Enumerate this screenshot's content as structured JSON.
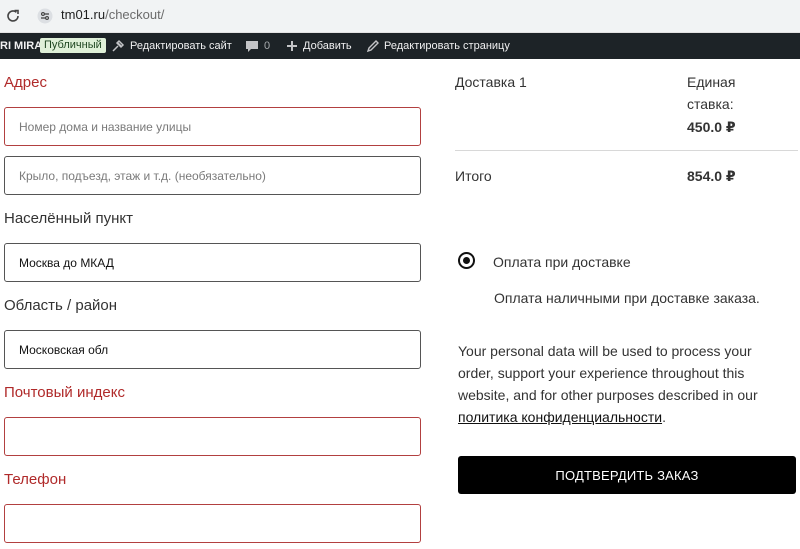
{
  "browser": {
    "domain": "tm01.ru",
    "path": "/checkout/"
  },
  "admin_bar": {
    "site_name": "RI MIRA",
    "badge": "Публичный",
    "edit_site": "Редактировать сайт",
    "comments_count": "0",
    "add_new": "Добавить",
    "edit_page": "Редактировать страницу"
  },
  "form": {
    "address": {
      "label": "Адрес",
      "street_placeholder": "Номер дома и название улицы",
      "street_value": "",
      "apartment_placeholder": "Крыло, подъезд, этаж и т.д. (необязательно)",
      "apartment_value": ""
    },
    "city": {
      "label": "Населённый пункт",
      "value": "Москва до МКАД"
    },
    "region": {
      "label": "Область / район",
      "value": "Московская обл"
    },
    "postcode": {
      "label": "Почтовый индекс",
      "value": ""
    },
    "phone": {
      "label": "Телефон",
      "value": ""
    }
  },
  "summary": {
    "shipping_label": "Доставка 1",
    "shipping_rate_line1": "Единая",
    "shipping_rate_line2": "ставка:",
    "shipping_amount": "450.0 ₽",
    "total_label": "Итого",
    "total_amount": "854.0 ₽"
  },
  "payment": {
    "method_label": "Оплата при доставке",
    "method_description": "Оплата наличными при доставке заказа.",
    "selected": true
  },
  "privacy": {
    "text": "Your personal data will be used to process your order, support your experience throughout this website, and for other purposes described in our",
    "link_text": "политика конфиденциальности",
    "suffix": "."
  },
  "submit_label": "ПОДТВЕРДИТЬ ЗАКАЗ",
  "colors": {
    "required_label": "#b02a2a",
    "admin_bar_bg": "#1d2327",
    "button_bg": "#000000"
  },
  "icons": [
    "reload-icon",
    "site-info-icon",
    "customize-icon",
    "comment-icon",
    "plus-icon",
    "pencil-icon"
  ]
}
